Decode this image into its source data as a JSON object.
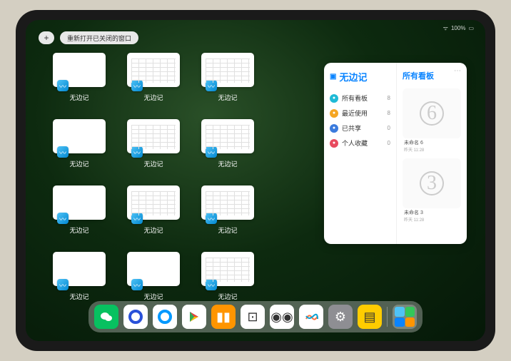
{
  "status": {
    "battery": "100%"
  },
  "controls": {
    "plus": "+",
    "reopen": "重新打开已关闭的窗口"
  },
  "window_label": "无边记",
  "windows": [
    {
      "variant": "blank"
    },
    {
      "variant": "grid"
    },
    {
      "variant": "grid"
    },
    {
      "variant": "blank"
    },
    {
      "variant": "grid"
    },
    {
      "variant": "grid"
    },
    {
      "variant": "blank"
    },
    {
      "variant": "grid"
    },
    {
      "variant": "grid"
    },
    {
      "variant": "blank"
    },
    {
      "variant": "blank"
    },
    {
      "variant": "grid"
    }
  ],
  "panel": {
    "app_name": "无边记",
    "right_title": "所有看板",
    "items": [
      {
        "label": "所有看板",
        "count": "8",
        "color": "#1fbad6"
      },
      {
        "label": "最近使用",
        "count": "8",
        "color": "#f5a623"
      },
      {
        "label": "已共享",
        "count": "0",
        "color": "#3b7bdd"
      },
      {
        "label": "个人收藏",
        "count": "0",
        "color": "#e84a5f"
      }
    ],
    "boards": [
      {
        "glyph": "6",
        "name": "未命名 6",
        "time": "昨天 11:28"
      },
      {
        "glyph": "3",
        "name": "未命名 3",
        "time": "昨天 11:28"
      }
    ]
  },
  "dock": {
    "apps": [
      {
        "name": "wechat",
        "bg": "#07c160",
        "glyph": "✦"
      },
      {
        "name": "quark",
        "bg": "#ffffff",
        "glyph": "◯"
      },
      {
        "name": "qqbrowser",
        "bg": "#ffffff",
        "glyph": "◯"
      },
      {
        "name": "play",
        "bg": "#ffffff",
        "glyph": "▶"
      },
      {
        "name": "books",
        "bg": "#ff9500",
        "glyph": "▮▮"
      },
      {
        "name": "dice",
        "bg": "#ffffff",
        "glyph": "⊡"
      },
      {
        "name": "connect",
        "bg": "#ffffff",
        "glyph": "◉◉"
      },
      {
        "name": "freeform",
        "bg": "#ffffff",
        "glyph": "〰"
      },
      {
        "name": "settings",
        "bg": "#8e8e93",
        "glyph": "⚙"
      },
      {
        "name": "notes",
        "bg": "#ffcc00",
        "glyph": "▤"
      }
    ]
  }
}
